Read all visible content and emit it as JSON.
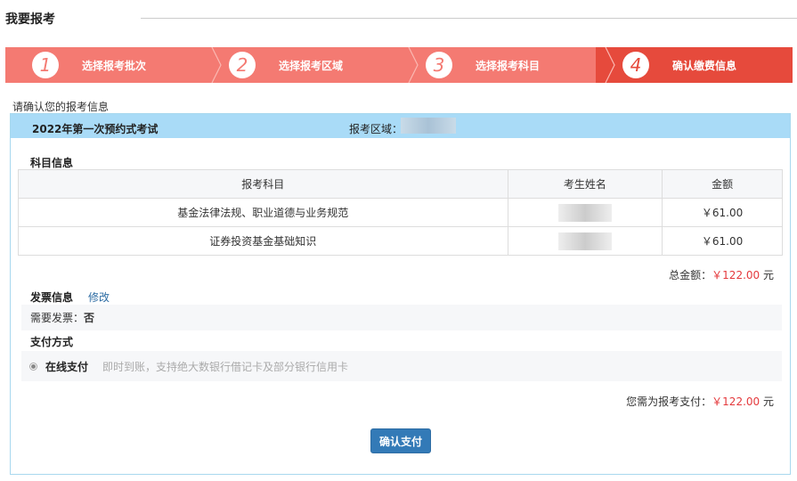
{
  "page_title": "我要报考",
  "steps": [
    {
      "num": "1",
      "label": "选择报考批次"
    },
    {
      "num": "2",
      "label": "选择报考区域"
    },
    {
      "num": "3",
      "label": "选择报考科目"
    },
    {
      "num": "4",
      "label": "确认缴费信息"
    }
  ],
  "colors": {
    "step_done": "#f47a72",
    "step_active": "#e64a3c",
    "panel_head": "#a9dbf7",
    "button": "#337ab7",
    "amount": "#e4393c"
  },
  "confirm_hint": "请确认您的报考信息",
  "exam": {
    "name": "2022年第一次预约式考试",
    "region_label": "报考区域："
  },
  "subjects": {
    "title": "科目信息",
    "headers": [
      "报考科目",
      "考生姓名",
      "金额"
    ],
    "rows": [
      {
        "subject": "基金法律法规、职业道德与业务规范",
        "amount": "￥61.00"
      },
      {
        "subject": "证券投资基金基础知识",
        "amount": "￥61.00"
      }
    ],
    "total_label": "总金额：",
    "total_value": "￥122.00",
    "total_unit": " 元"
  },
  "invoice": {
    "title": "发票信息",
    "edit": "修改",
    "need_label": "需要发票：",
    "need_value": "否"
  },
  "payment": {
    "title": "支付方式",
    "method": "在线支付",
    "desc": "即时到账，支持绝大数银行借记卡及部分银行信用卡",
    "need_pay_label": "您需为报考支付：",
    "need_pay_value": "￥122.00",
    "need_pay_unit": " 元",
    "button": "确认支付"
  }
}
